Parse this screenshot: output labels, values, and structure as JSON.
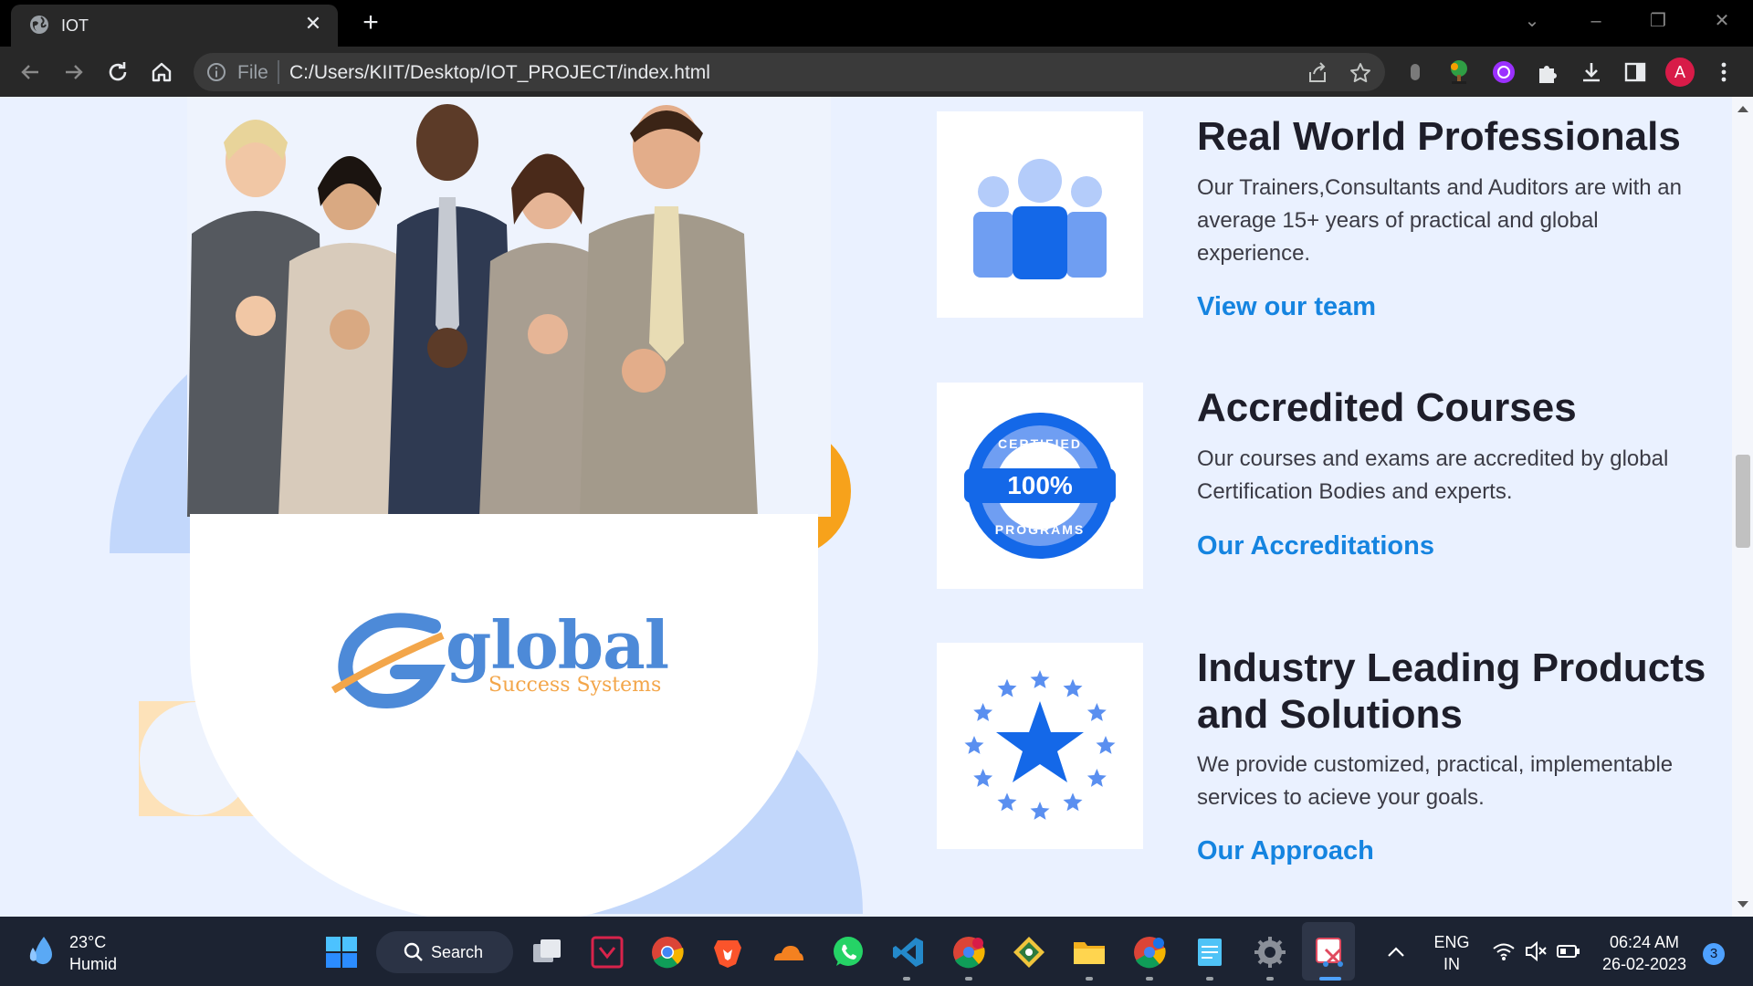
{
  "browser": {
    "tab_title": "IOT",
    "omnibox_scheme": "File",
    "url": "C:/Users/KIIT/Desktop/IOT_PROJECT/index.html",
    "profile_initial": "A"
  },
  "page": {
    "logo_text": "global",
    "logo_subtext": "Success Systems",
    "features": [
      {
        "icon": "team-icon",
        "title": "Real World Professionals",
        "description": "Our Trainers,Consultants and Auditors are with an average 15+ years of practical and global experience.",
        "link": "View our team"
      },
      {
        "icon": "certified-badge-icon",
        "badge_top": "CERTIFIED",
        "badge_middle": "100%",
        "badge_bottom": "PROGRAMS",
        "title": "Accredited Courses",
        "description": "Our courses and exams are accredited by global Certification Bodies and experts.",
        "link": "Our Accreditations"
      },
      {
        "icon": "star-ring-icon",
        "title": "Industry Leading Products and Solutions",
        "description": "We provide customized, practical, implementable services to acieve your goals.",
        "link": "Our Approach"
      }
    ],
    "colors": {
      "background": "#eaf1ff",
      "accent_blue": "#1584e0",
      "shape_blue": "#c2d7fb",
      "shape_orange": "#f7a21b",
      "shape_peach": "#fde2b9"
    }
  },
  "taskbar": {
    "weather_temp": "23°C",
    "weather_desc": "Humid",
    "search_label": "Search",
    "language": "ENG",
    "region": "IN",
    "time": "06:24 AM",
    "date": "26-02-2023",
    "notification_count": "3"
  }
}
